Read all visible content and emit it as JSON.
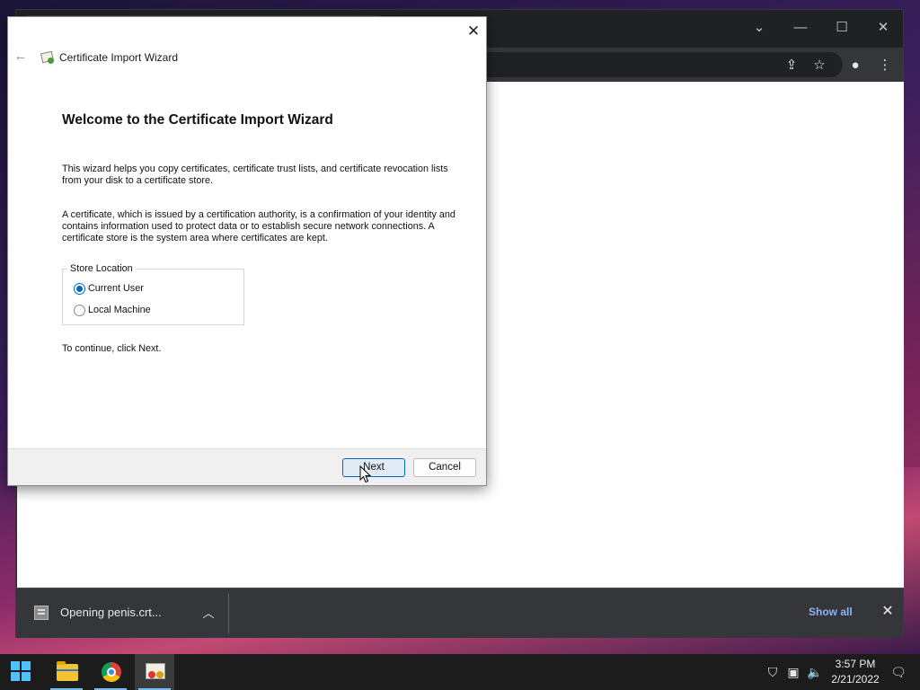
{
  "wizard": {
    "app_title": "Certificate Import Wizard",
    "heading": "Welcome to the Certificate Import Wizard",
    "paragraph1": "This wizard helps you copy certificates, certificate trust lists, and certificate revocation lists from your disk to a certificate store.",
    "paragraph2": "A certificate, which is issued by a certification authority, is a confirmation of your identity and contains information used to protect data or to establish secure network connections. A certificate store is the system area where certificates are kept.",
    "store_location": {
      "legend": "Store Location",
      "options": [
        {
          "label": "Current User",
          "selected": true
        },
        {
          "label": "Local Machine",
          "selected": false
        }
      ]
    },
    "continue_text": "To continue, click Next.",
    "buttons": {
      "next": "Next",
      "cancel": "Cancel"
    }
  },
  "browser": {
    "download_shelf": {
      "item_label": "Opening penis.crt...",
      "show_all": "Show all"
    }
  },
  "taskbar": {
    "apps": [
      "start-icon",
      "file-explorer-icon",
      "chrome-icon",
      "certificate-manager-icon"
    ],
    "clock": {
      "time": "3:57 PM",
      "date": "2/21/2022"
    }
  },
  "colors": {
    "accent": "#0067c0",
    "link": "#8ab4f8",
    "taskbar": "#1c1c1c"
  }
}
